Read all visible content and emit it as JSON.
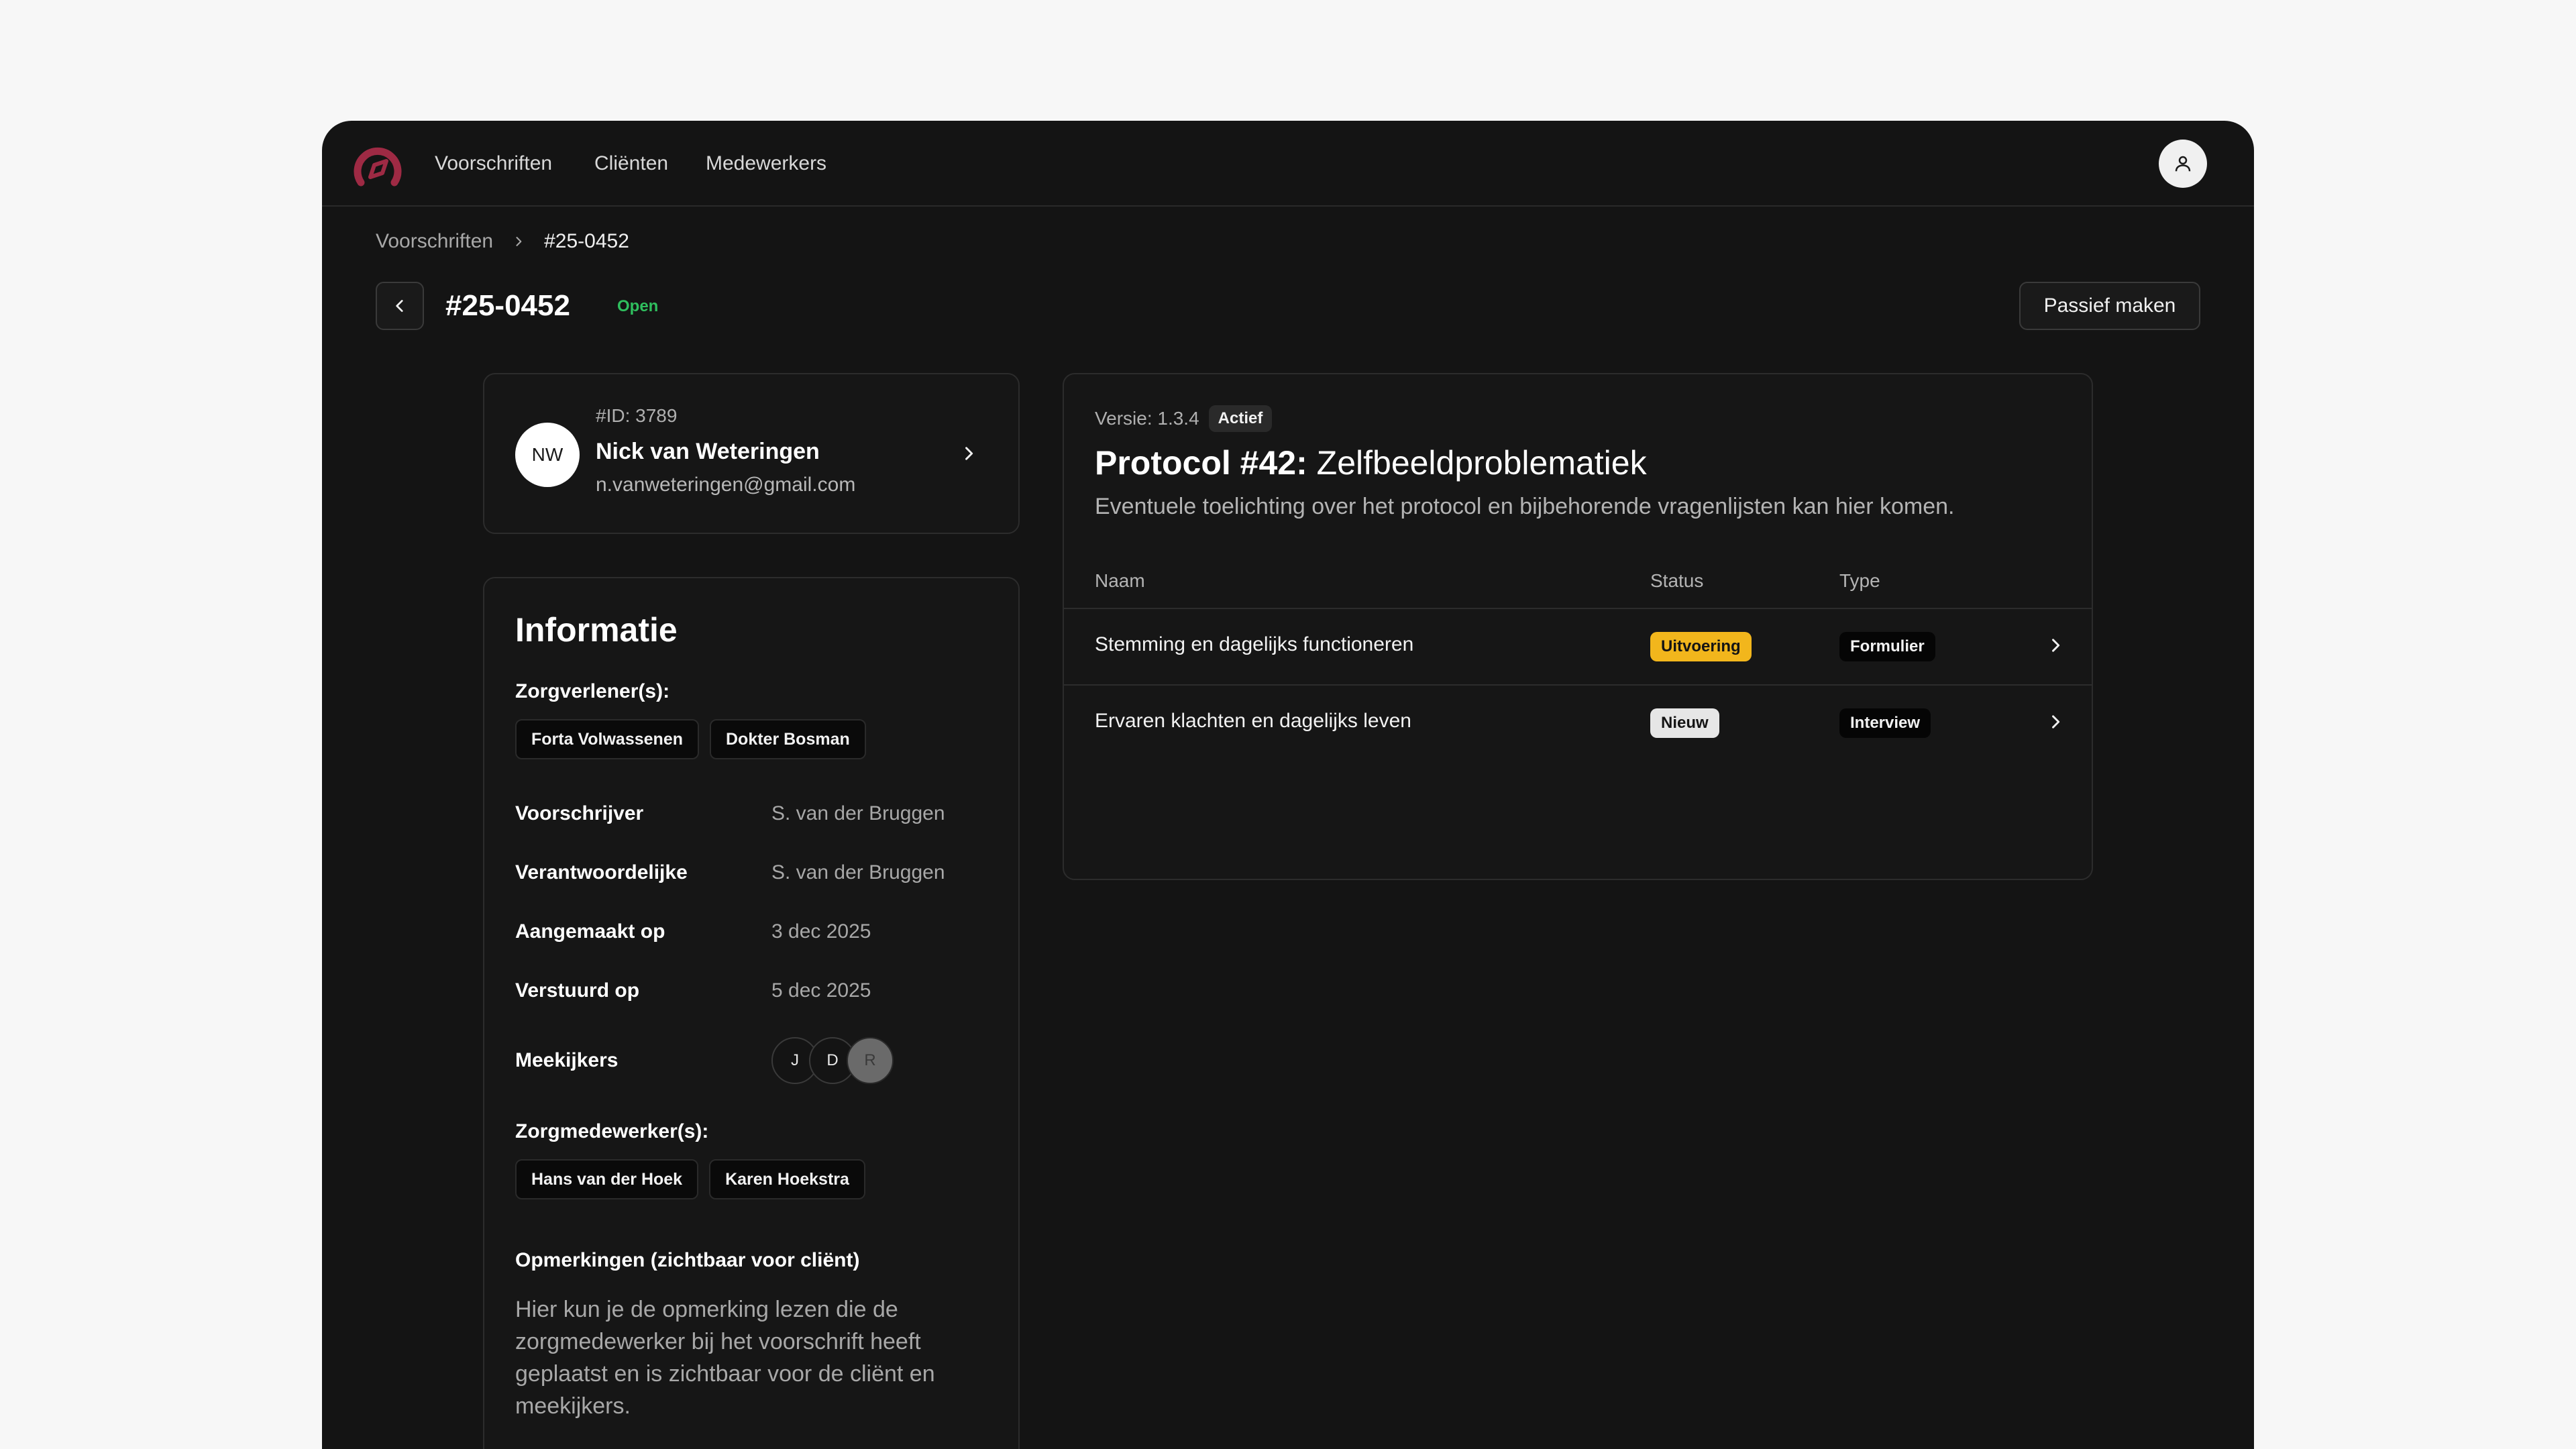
{
  "nav": {
    "items": [
      "Voorschriften",
      "Cliënten",
      "Medewerkers"
    ]
  },
  "icons": {
    "logo": "compass-logo-icon",
    "user": "user-icon",
    "back": "chevron-left-icon",
    "chevron": "chevron-right-icon"
  },
  "colors": {
    "brand": "#9e2a44",
    "status_open": "#2fbf5e",
    "status_uitvoering": "#f2b61c",
    "status_nieuw": "#e6e6e6"
  },
  "breadcrumb": {
    "parent": "Voorschriften",
    "current": "#25-0452"
  },
  "header": {
    "title": "#25-0452",
    "status": "Open",
    "passief_button": "Passief maken"
  },
  "client": {
    "initials": "NW",
    "id": "#ID: 3789",
    "name": "Nick van Weteringen",
    "email": "n.vanweteringen@gmail.com"
  },
  "info": {
    "title": "Informatie",
    "zorgverleners_label": "Zorgverlener(s):",
    "zorgverleners": [
      "Forta Volwassenen",
      "Dokter Bosman"
    ],
    "rows": [
      {
        "key": "Voorschrijver",
        "value": "S. van der Bruggen"
      },
      {
        "key": "Verantwoordelijke",
        "value": "S. van der Bruggen"
      },
      {
        "key": "Aangemaakt op",
        "value": "3 dec 2025"
      },
      {
        "key": "Verstuurd op",
        "value": "5 dec 2025"
      }
    ],
    "meekijkers_label": "Meekijkers",
    "meekijkers": [
      "J",
      "D",
      "R"
    ],
    "zorgmedewerkers_label": "Zorgmedewerker(s):",
    "zorgmedewerkers": [
      "Hans van der Hoek",
      "Karen Hoekstra"
    ],
    "remarks_label": "Opmerkingen (zichtbaar voor cliënt)",
    "remarks_text": "Hier kun je de opmerking lezen die de zorgmedewerker bij het voorschrift heeft geplaatst en is zichtbaar voor de cliënt en meekijkers."
  },
  "protocol": {
    "version": "Versie: 1.3.4",
    "version_badge": "Actief",
    "title_bold": "Protocol #42:",
    "title_rest": "Zelfbeeldproblematiek",
    "description": "Eventuele toelichting over het protocol en bijbehorende vragenlijsten kan hier komen.",
    "columns": [
      "Naam",
      "Status",
      "Type"
    ],
    "rows": [
      {
        "name": "Stemming en dagelijks functioneren",
        "status": "Uitvoering",
        "type": "Formulier"
      },
      {
        "name": "Ervaren klachten en dagelijks leven",
        "status": "Nieuw",
        "type": "Interview"
      }
    ]
  }
}
